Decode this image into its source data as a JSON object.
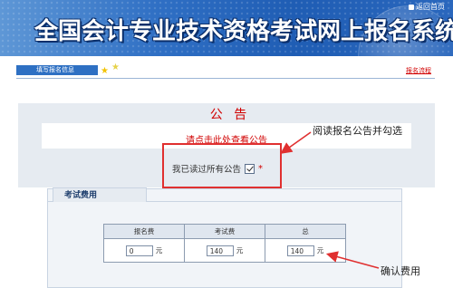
{
  "header": {
    "title": "全国会计专业技术资格考试网上报名系统",
    "home_link": "返回首页"
  },
  "stepbar": {
    "current_step": "填写报名信息",
    "flow_link": "报名流程"
  },
  "notice": {
    "title": "公 告",
    "link_text": "请点击此处查看公告",
    "read_label": "我已读过所有公告",
    "read_checked": true,
    "required_mark": "*"
  },
  "annotations": {
    "notice_hint": "阅读报名公告并勾选",
    "fee_hint": "确认费用",
    "color": "#e03030"
  },
  "fees": {
    "tab_label": "考试费用",
    "columns": [
      "报名费",
      "考试费",
      "总"
    ],
    "values": [
      "0",
      "140",
      "140"
    ],
    "unit": "元"
  },
  "colors": {
    "banner": "#2f6fc4",
    "accent_red": "#d10000",
    "panel_bg": "#e6ebf1"
  }
}
